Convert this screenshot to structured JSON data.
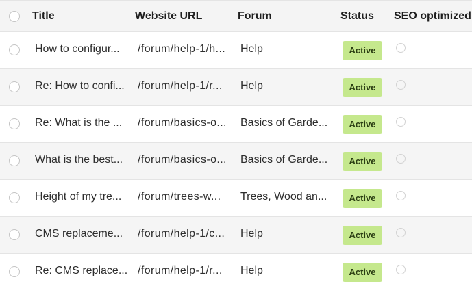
{
  "table": {
    "columns": {
      "title": "Title",
      "url": "Website URL",
      "forum": "Forum",
      "status": "Status",
      "seo": "SEO optimized"
    },
    "rows": [
      {
        "title": "How to configur...",
        "url": "/forum/help-1/h...",
        "forum": "Help",
        "status": "Active"
      },
      {
        "title": "Re: How to confi...",
        "url": "/forum/help-1/r...",
        "forum": "Help",
        "status": "Active"
      },
      {
        "title": "Re: What is the ...",
        "url": "/forum/basics-o...",
        "forum": "Basics of Garde...",
        "status": "Active"
      },
      {
        "title": "What is the best...",
        "url": "/forum/basics-o...",
        "forum": "Basics of Garde...",
        "status": "Active"
      },
      {
        "title": "Height of my tre...",
        "url": "/forum/trees-w...",
        "forum": "Trees, Wood an...",
        "status": "Active"
      },
      {
        "title": "CMS replaceme...",
        "url": "/forum/help-1/c...",
        "forum": "Help",
        "status": "Active"
      },
      {
        "title": "Re: CMS replace...",
        "url": "/forum/help-1/r...",
        "forum": "Help",
        "status": "Active"
      }
    ]
  },
  "colors": {
    "badge_bg": "#c5e88d",
    "row_alt_bg": "#f5f5f5",
    "header_bg": "#f4f4f4"
  }
}
